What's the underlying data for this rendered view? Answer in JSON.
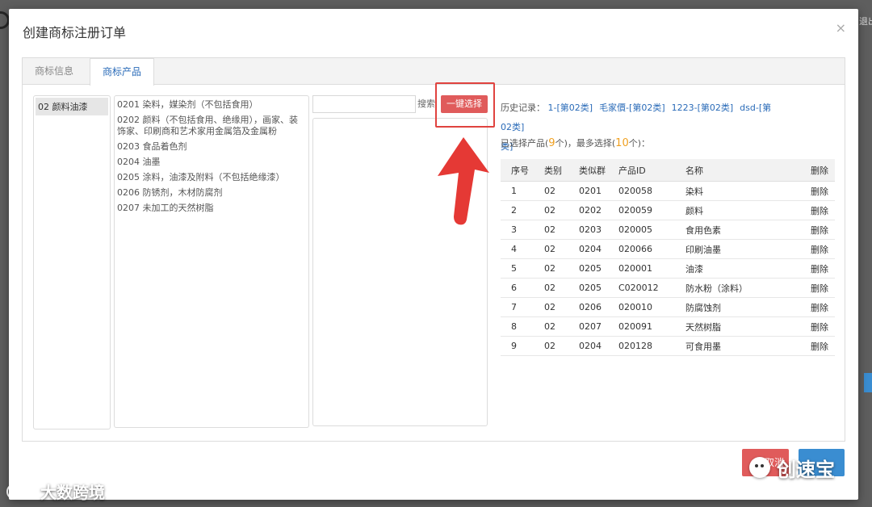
{
  "background": {
    "exit_text": "退出"
  },
  "modal": {
    "title": "创建商标注册订单",
    "close_icon": "×",
    "tabs": [
      {
        "label": "商标信息",
        "active": false
      },
      {
        "label": "商标产品",
        "active": true
      }
    ],
    "categories": [
      {
        "label": "02 颜料油漆",
        "selected": true
      }
    ],
    "groups": [
      "0201 染料，媒染剂（不包括食用）",
      "0202 颜料（不包括食用、绝缘用），画家、装饰家、印刷商和艺术家用金属箔及金属粉",
      "0203 食品着色剂",
      "0204 油墨",
      "0205 涂料，油漆及附料（不包括绝缘漆）",
      "0206 防锈剂，木材防腐剂",
      "0207 未加工的天然树脂"
    ],
    "search": {
      "placeholder": "",
      "button_label": "搜索"
    },
    "onekey_label": "一键选择",
    "history": {
      "label": "历史记录：",
      "links": [
        "1-[第02类]",
        "毛家價-[第02类]",
        "1223-[第02类]",
        "dsd-[第02类]",
        "类]"
      ]
    },
    "selected": {
      "prefix": "已选择产品(",
      "count": "9",
      "middle": "个)，最多选择(",
      "max": "10",
      "suffix": "个)："
    },
    "table": {
      "headers": [
        "序号",
        "类别",
        "类似群",
        "产品ID",
        "名称",
        "删除"
      ],
      "rows": [
        [
          "1",
          "02",
          "0201",
          "020058",
          "染料",
          "删除"
        ],
        [
          "2",
          "02",
          "0202",
          "020059",
          "颜料",
          "删除"
        ],
        [
          "3",
          "02",
          "0203",
          "020005",
          "食用色素",
          "删除"
        ],
        [
          "4",
          "02",
          "0204",
          "020066",
          "印刷油墨",
          "删除"
        ],
        [
          "5",
          "02",
          "0205",
          "020001",
          "油漆",
          "删除"
        ],
        [
          "6",
          "02",
          "0205",
          "C020012",
          "防水粉（涂料）",
          "删除"
        ],
        [
          "7",
          "02",
          "0206",
          "020010",
          "防腐蚀剂",
          "删除"
        ],
        [
          "8",
          "02",
          "0207",
          "020091",
          "天然树脂",
          "删除"
        ],
        [
          "9",
          "02",
          "0204",
          "020128",
          "可食用墨",
          "删除"
        ]
      ]
    },
    "cancel_label": "取消"
  },
  "watermarks": {
    "right": "创速宝",
    "left": "大数跨境"
  },
  "colors": {
    "accent_red": "#e05b5b",
    "link_blue": "#2a6bb8",
    "confirm_blue": "#3a8dd1",
    "highlight_red": "#e0433f"
  }
}
